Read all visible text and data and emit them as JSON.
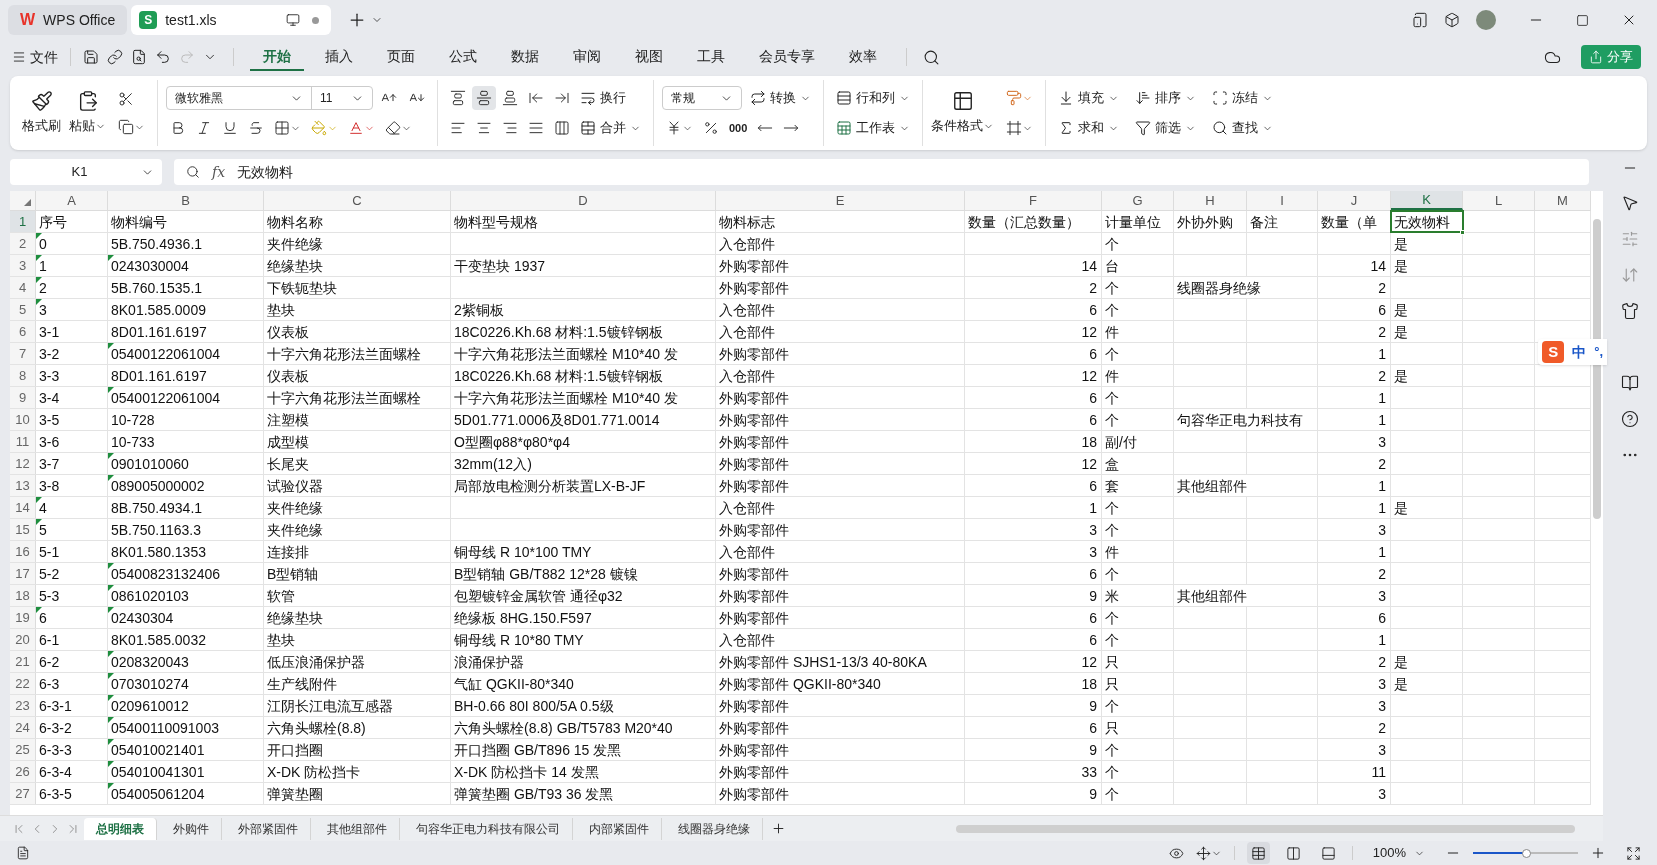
{
  "window": {
    "app_tab": {
      "logo": "W",
      "label": "WPS Office"
    },
    "doc_tab": {
      "logo": "S",
      "label": "test1.xls",
      "selected": true,
      "unsaved": true
    }
  },
  "menu": {
    "file": "文件",
    "redo_disabled": true,
    "tabs": [
      {
        "label": "开始",
        "selected": true
      },
      {
        "label": "插入",
        "selected": false
      },
      {
        "label": "页面",
        "selected": false
      },
      {
        "label": "公式",
        "selected": false
      },
      {
        "label": "数据",
        "selected": false
      },
      {
        "label": "审阅",
        "selected": false
      },
      {
        "label": "视图",
        "selected": false
      },
      {
        "label": "工具",
        "selected": false
      },
      {
        "label": "会员专享",
        "selected": false
      },
      {
        "label": "效率",
        "selected": false
      }
    ],
    "share": "分享"
  },
  "ribbon": {
    "clipboard": {
      "format_painter": "格式刷",
      "paste": "粘贴"
    },
    "font": {
      "family": "微软雅黑",
      "size": "11"
    },
    "alignment": {
      "vertical_align": [
        {
          "selected": false
        },
        {
          "selected": true
        },
        {
          "selected": false
        }
      ],
      "wrap": "换行",
      "merge": "合并"
    },
    "number": {
      "format": "常规",
      "convert": "转换",
      "thousands": "000"
    },
    "cells": {
      "rows_cols": "行和列",
      "sheet": "工作表"
    },
    "styles": {
      "conditional": "条件格式"
    },
    "editing": [
      "填充",
      "排序",
      "冻结",
      "求和",
      "筛选",
      "查找"
    ]
  },
  "formula_bar": {
    "name_box": "K1",
    "fx": "fx",
    "value": "无效物料"
  },
  "columns": [
    {
      "letter": "A",
      "selected": false,
      "numeric": false
    },
    {
      "letter": "B",
      "selected": false,
      "numeric": false
    },
    {
      "letter": "C",
      "selected": false,
      "numeric": false
    },
    {
      "letter": "D",
      "selected": false,
      "numeric": false
    },
    {
      "letter": "E",
      "selected": false,
      "numeric": false
    },
    {
      "letter": "F",
      "selected": false,
      "numeric": true
    },
    {
      "letter": "G",
      "selected": false,
      "numeric": false
    },
    {
      "letter": "H",
      "selected": false,
      "numeric": false
    },
    {
      "letter": "I",
      "selected": false,
      "numeric": false
    },
    {
      "letter": "J",
      "selected": false,
      "numeric": true
    },
    {
      "letter": "K",
      "selected": true,
      "numeric": false
    },
    {
      "letter": "L",
      "selected": false,
      "numeric": false
    },
    {
      "letter": "M",
      "selected": false,
      "numeric": false
    }
  ],
  "rows": [
    {
      "row": "1",
      "selected": true,
      "flag_a": false,
      "flag_b": false,
      "cells": {
        "A": "序号",
        "B": "物料编号",
        "C": "物料名称",
        "D": "物料型号规格",
        "E": "物料标志",
        "F": "数量（汇总数量）",
        "G": "计量单位",
        "H": "外协外购",
        "I": "备注",
        "J": "数量（单",
        "K": "无效物料"
      }
    },
    {
      "row": "2",
      "selected": false,
      "flag_a": true,
      "flag_b": false,
      "cells": {
        "A": "0",
        "B": "5B.750.4936.1",
        "C": "夹件绝缘",
        "E": "入仓部件",
        "G": "个",
        "K": "是"
      }
    },
    {
      "row": "3",
      "selected": false,
      "flag_a": true,
      "flag_b": true,
      "cells": {
        "A": "1",
        "B": "0243030004",
        "C": "绝缘垫块",
        "D": "干变垫块 1937",
        "E": "外购零部件",
        "F": "14",
        "G": "台",
        "J": "14",
        "K": "是"
      }
    },
    {
      "row": "4",
      "selected": false,
      "flag_a": true,
      "flag_b": false,
      "cells": {
        "A": "2",
        "B": "5B.760.1535.1",
        "C": "下铁轭垫块",
        "E": "外购零部件",
        "F": "2",
        "G": "个",
        "H": "线圈器身绝缘",
        "J": "2"
      }
    },
    {
      "row": "5",
      "selected": false,
      "flag_a": true,
      "flag_b": false,
      "cells": {
        "A": "3",
        "B": "8K01.585.0009",
        "C": "垫块",
        "D": "2紫铜板",
        "E": "入仓部件",
        "F": "6",
        "G": "个",
        "J": "6",
        "K": "是"
      }
    },
    {
      "row": "6",
      "selected": false,
      "flag_a": false,
      "flag_b": false,
      "cells": {
        "A": "3-1",
        "B": "8D01.161.6197",
        "C": "仪表板",
        "D": "18C0226.Kh.68 材料:1.5镀锌钢板",
        "E": "入仓部件",
        "F": "12",
        "G": "件",
        "J": "2",
        "K": "是"
      }
    },
    {
      "row": "7",
      "selected": false,
      "flag_a": false,
      "flag_b": true,
      "cells": {
        "A": "3-2",
        "B": "05400122061004",
        "C": "十字六角花形法兰面螺栓",
        "D": "十字六角花形法兰面螺栓 M10*40 发",
        "E": "外购零部件",
        "F": "6",
        "G": "个",
        "J": "1"
      }
    },
    {
      "row": "8",
      "selected": false,
      "flag_a": false,
      "flag_b": false,
      "cells": {
        "A": "3-3",
        "B": "8D01.161.6197",
        "C": "仪表板",
        "D": "18C0226.Kh.68 材料:1.5镀锌钢板",
        "E": "入仓部件",
        "F": "12",
        "G": "件",
        "J": "2",
        "K": "是"
      }
    },
    {
      "row": "9",
      "selected": false,
      "flag_a": false,
      "flag_b": true,
      "cells": {
        "A": "3-4",
        "B": "05400122061004",
        "C": "十字六角花形法兰面螺栓",
        "D": "十字六角花形法兰面螺栓 M10*40 发",
        "E": "外购零部件",
        "F": "6",
        "G": "个",
        "J": "1"
      }
    },
    {
      "row": "10",
      "selected": false,
      "flag_a": false,
      "flag_b": false,
      "cells": {
        "A": "3-5",
        "B": "10-728",
        "C": "注塑模",
        "D": "5D01.771.0006及8D01.771.0014",
        "E": "外购零部件",
        "F": "6",
        "G": "个",
        "H": "句容华正电力科技有",
        "J": "1"
      }
    },
    {
      "row": "11",
      "selected": false,
      "flag_a": false,
      "flag_b": false,
      "cells": {
        "A": "3-6",
        "B": "10-733",
        "C": "成型模",
        "D": "O型圈φ88*φ80*φ4",
        "E": "外购零部件",
        "F": "18",
        "G": "副/付",
        "J": "3"
      }
    },
    {
      "row": "12",
      "selected": false,
      "flag_a": false,
      "flag_b": true,
      "cells": {
        "A": "3-7",
        "B": "0901010060",
        "C": "长尾夹",
        "D": "32mm(12入)",
        "E": "外购零部件",
        "F": "12",
        "G": "盒",
        "J": "2"
      }
    },
    {
      "row": "13",
      "selected": false,
      "flag_a": false,
      "flag_b": true,
      "cells": {
        "A": "3-8",
        "B": "089005000002",
        "C": "试验仪器",
        "D": "局部放电检测分析装置LX-B-JF",
        "E": "外购零部件",
        "F": "6",
        "G": "套",
        "H": "其他组部件",
        "J": "1"
      }
    },
    {
      "row": "14",
      "selected": false,
      "flag_a": true,
      "flag_b": false,
      "cells": {
        "A": "4",
        "B": "8B.750.4934.1",
        "C": "夹件绝缘",
        "E": "入仓部件",
        "F": "1",
        "G": "个",
        "J": "1",
        "K": "是"
      }
    },
    {
      "row": "15",
      "selected": false,
      "flag_a": true,
      "flag_b": false,
      "cells": {
        "A": "5",
        "B": "5B.750.1163.3",
        "C": "夹件绝缘",
        "E": "外购零部件",
        "F": "3",
        "G": "个",
        "J": "3"
      }
    },
    {
      "row": "16",
      "selected": false,
      "flag_a": false,
      "flag_b": false,
      "cells": {
        "A": "5-1",
        "B": "8K01.580.1353",
        "C": "连接排",
        "D": "铜母线 R 10*100 TMY",
        "E": "入仓部件",
        "F": "3",
        "G": "件",
        "J": "1"
      }
    },
    {
      "row": "17",
      "selected": false,
      "flag_a": false,
      "flag_b": true,
      "cells": {
        "A": "5-2",
        "B": "05400823132406",
        "C": "B型销轴",
        "D": "B型销轴 GB/T882 12*28 镀镍",
        "E": "外购零部件",
        "F": "6",
        "G": "个",
        "J": "2"
      }
    },
    {
      "row": "18",
      "selected": false,
      "flag_a": false,
      "flag_b": true,
      "cells": {
        "A": "5-3",
        "B": "0861020103",
        "C": "软管",
        "D": "包塑镀锌金属软管 通径φ32",
        "E": "外购零部件",
        "F": "9",
        "G": "米",
        "H": "其他组部件",
        "J": "3"
      }
    },
    {
      "row": "19",
      "selected": false,
      "flag_a": true,
      "flag_b": true,
      "cells": {
        "A": "6",
        "B": "02430304",
        "C": "绝缘垫块",
        "D": "绝缘板 8HG.150.F597",
        "E": "外购零部件",
        "F": "6",
        "G": "个",
        "J": "6"
      }
    },
    {
      "row": "20",
      "selected": false,
      "flag_a": false,
      "flag_b": false,
      "cells": {
        "A": "6-1",
        "B": "8K01.585.0032",
        "C": "垫块",
        "D": "铜母线 R 10*80 TMY",
        "E": "入仓部件",
        "F": "6",
        "G": "个",
        "J": "1"
      }
    },
    {
      "row": "21",
      "selected": false,
      "flag_a": false,
      "flag_b": true,
      "cells": {
        "A": "6-2",
        "B": "0208320043",
        "C": "低压浪涌保护器",
        "D": "浪涌保护器",
        "E": "外购零部件  SJHS1-13/3 40-80KA",
        "F": "12",
        "G": "只",
        "J": "2",
        "K": "是"
      }
    },
    {
      "row": "22",
      "selected": false,
      "flag_a": false,
      "flag_b": true,
      "cells": {
        "A": "6-3",
        "B": "0703010274",
        "C": "生产线附件",
        "D": "气缸 QGKII-80*340",
        "E": "外购零部件 QGKII-80*340",
        "F": "18",
        "G": "只",
        "J": "3",
        "K": "是"
      }
    },
    {
      "row": "23",
      "selected": false,
      "flag_a": false,
      "flag_b": true,
      "cells": {
        "A": "6-3-1",
        "B": "0209610012",
        "C": "江阴长江电流互感器",
        "D": "BH-0.66 80I 800/5A 0.5级",
        "E": "外购零部件",
        "F": "9",
        "G": "个",
        "J": "3"
      }
    },
    {
      "row": "24",
      "selected": false,
      "flag_a": false,
      "flag_b": true,
      "cells": {
        "A": "6-3-2",
        "B": "05400110091003",
        "C": "六角头螺栓(8.8)",
        "D": "六角头螺栓(8.8) GB/T5783 M20*40",
        "E": "外购零部件",
        "F": "6",
        "G": "只",
        "J": "2"
      }
    },
    {
      "row": "25",
      "selected": false,
      "flag_a": false,
      "flag_b": true,
      "cells": {
        "A": "6-3-3",
        "B": "054010021401",
        "C": "开口挡圈",
        "D": "开口挡圈 GB/T896 15 发黑",
        "E": "外购零部件",
        "F": "9",
        "G": "个",
        "J": "3"
      }
    },
    {
      "row": "26",
      "selected": false,
      "flag_a": false,
      "flag_b": true,
      "cells": {
        "A": "6-3-4",
        "B": "054010041301",
        "C": "X-DK 防松挡卡",
        "D": "X-DK 防松挡卡 14 发黑",
        "E": "外购零部件",
        "F": "33",
        "G": "个",
        "J": "11"
      }
    },
    {
      "row": "27",
      "selected": false,
      "flag_a": false,
      "flag_b": true,
      "cells": {
        "A": "6-3-5",
        "B": "054005061204",
        "C": "弹簧垫圈",
        "D": "弹簧垫圈 GB/T93 36 发黑",
        "E": "外购零部件",
        "F": "9",
        "G": "个",
        "J": "3"
      }
    }
  ],
  "ime": {
    "logo": "S",
    "mode": "中",
    "punct": "°,"
  },
  "sheet_tabs": [
    {
      "label": "总明细表",
      "selected": true
    },
    {
      "label": "外购件",
      "selected": false
    },
    {
      "label": "外部紧固件",
      "selected": false
    },
    {
      "label": "其他组部件",
      "selected": false
    },
    {
      "label": "句容华正电力科技有限公司",
      "selected": false
    },
    {
      "label": "内部紧固件",
      "selected": false
    },
    {
      "label": "线圈器身绝缘",
      "selected": false
    }
  ],
  "status_bar": {
    "view_modes": [
      {
        "selected": true
      },
      {
        "selected": false
      },
      {
        "selected": false
      }
    ],
    "zoom": "100%",
    "zoom_slider": {
      "level": 0.5
    }
  }
}
